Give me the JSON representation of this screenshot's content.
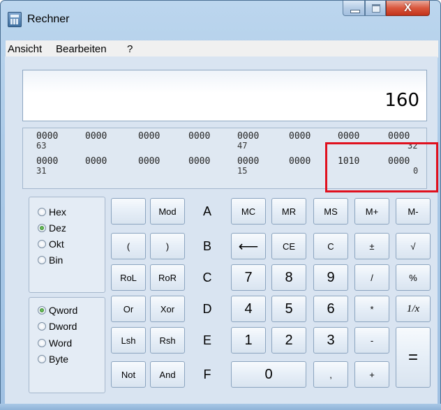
{
  "window": {
    "title": "Rechner",
    "close_glyph": "X"
  },
  "menu": [
    "Ansicht",
    "Bearbeiten",
    "?"
  ],
  "display": {
    "value": "160"
  },
  "bits": {
    "row1": [
      "0000",
      "0000",
      "0000",
      "0000",
      "0000",
      "0000",
      "0000",
      "0000"
    ],
    "row1_index": {
      "left": "63",
      "mid": "47",
      "right": "32"
    },
    "row2": [
      "0000",
      "0000",
      "0000",
      "0000",
      "0000",
      "0000",
      "1010",
      "0000"
    ],
    "row2_index": {
      "left": "31",
      "mid": "15",
      "right": "0"
    }
  },
  "base_group": {
    "options": [
      "Hex",
      "Dez",
      "Okt",
      "Bin"
    ],
    "selected": "Dez"
  },
  "word_group": {
    "options": [
      "Qword",
      "Dword",
      "Word",
      "Byte"
    ],
    "selected": "Qword"
  },
  "buttons": {
    "blank": "",
    "mod": "Mod",
    "a": "A",
    "mc": "MC",
    "mr": "MR",
    "ms": "MS",
    "mplus": "M+",
    "mminus": "M-",
    "lparen": "(",
    "rparen": ")",
    "b": "B",
    "back": "⟵",
    "ce": "CE",
    "c": "C",
    "plusminus": "±",
    "sqrt": "√",
    "rol": "RoL",
    "ror": "RoR",
    "hex_c": "C",
    "seven": "7",
    "eight": "8",
    "nine": "9",
    "div": "/",
    "pct": "%",
    "or": "Or",
    "xor": "Xor",
    "d": "D",
    "four": "4",
    "five": "5",
    "six": "6",
    "mul": "*",
    "recip": "1/x",
    "lsh": "Lsh",
    "rsh": "Rsh",
    "e": "E",
    "one": "1",
    "two": "2",
    "three": "3",
    "minus": "-",
    "eq": "=",
    "not": "Not",
    "and": "And",
    "f": "F",
    "zero": "0",
    "comma": ",",
    "plus": "+"
  }
}
